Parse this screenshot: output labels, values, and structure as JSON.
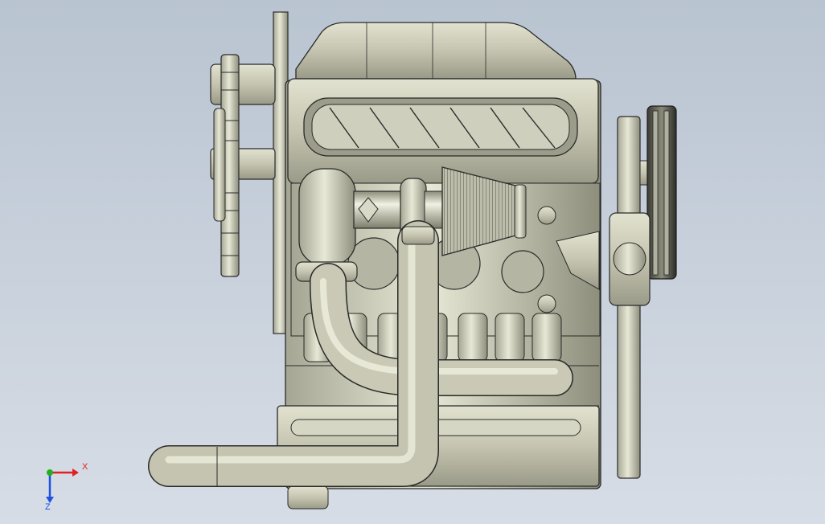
{
  "viewport": {
    "background_top": "#b9c4d1",
    "background_bottom": "#d7dde6"
  },
  "model": {
    "body_color": "#c8c8b4",
    "shadow_color": "#8e8e7c",
    "edge_color": "#2a2a2a"
  },
  "triad": {
    "x_label": "X",
    "z_label": "Z",
    "x_color": "#e02020",
    "y_color": "#20b020",
    "z_color": "#2050e0"
  }
}
